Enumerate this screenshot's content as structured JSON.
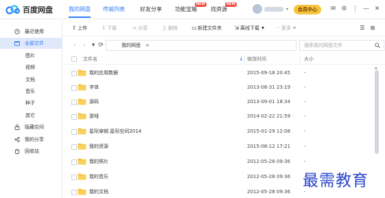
{
  "app": {
    "logo_text": "百度网盘"
  },
  "nav": [
    {
      "label": "我的网盘",
      "active": true,
      "badge": ""
    },
    {
      "label": "传输列表",
      "active": false,
      "badge": ""
    },
    {
      "label": "好友分享",
      "active": false,
      "badge": ""
    },
    {
      "label": "功能宝箱",
      "active": false,
      "badge": "NEW"
    },
    {
      "label": "找资源",
      "active": false,
      "badge": "NEW"
    }
  ],
  "user": {
    "vip_label": "会员中心"
  },
  "sidebar": {
    "items": [
      {
        "label": "最近使用",
        "icon": "clock-icon"
      },
      {
        "label": "全部文件",
        "icon": "folder-icon",
        "active": true
      },
      {
        "label": "图片",
        "icon": ""
      },
      {
        "label": "视频",
        "icon": ""
      },
      {
        "label": "文档",
        "icon": ""
      },
      {
        "label": "音乐",
        "icon": ""
      },
      {
        "label": "种子",
        "icon": ""
      },
      {
        "label": "其它",
        "icon": ""
      },
      {
        "label": "隐藏空间",
        "icon": "lock-icon"
      },
      {
        "label": "我的分享",
        "icon": "share-icon"
      },
      {
        "label": "回收站",
        "icon": "trash-icon"
      }
    ]
  },
  "toolbar": {
    "upload": "上传",
    "download": "下载",
    "share": "分享",
    "delete": "删除",
    "new_folder": "新建文件夹",
    "offline_download": "离线下载",
    "more": "更多"
  },
  "address": {
    "crumb": "我的网盘",
    "separator": ">",
    "search_placeholder": "搜索我的网盘文件"
  },
  "list": {
    "headers": {
      "name": "文件名",
      "modified": "修改时间",
      "size": "大小"
    },
    "rows": [
      {
        "name": "我的应用数据",
        "modified": "2015-09-18 20:45",
        "size": "-"
      },
      {
        "name": "字体",
        "modified": "2013-08-31 23:19",
        "size": "-"
      },
      {
        "name": "源码",
        "modified": "2013-09-01 18:34",
        "size": "-"
      },
      {
        "name": "游戏",
        "modified": "2014-02-22 21:59",
        "size": "-"
      },
      {
        "name": "星际穿越.星际空间2014",
        "modified": "2015-01-29 12:08",
        "size": "-"
      },
      {
        "name": "我的资源",
        "modified": "2015-08-12 17:21",
        "size": "-"
      },
      {
        "name": "我的照片",
        "modified": "2012-05-28 09:36",
        "size": "-"
      },
      {
        "name": "我的音乐",
        "modified": "2012-05-28 09:36",
        "size": "-"
      },
      {
        "name": "我的文档",
        "modified": "2012-05-28 09:36",
        "size": "-"
      }
    ]
  },
  "watermark": "最需教育",
  "colors": {
    "accent": "#2f7cf6",
    "folder": "#f6c342",
    "vip": "#f7c33d",
    "badge": "#f24b3d",
    "sidebar_active_bg": "#dfe9f9"
  }
}
